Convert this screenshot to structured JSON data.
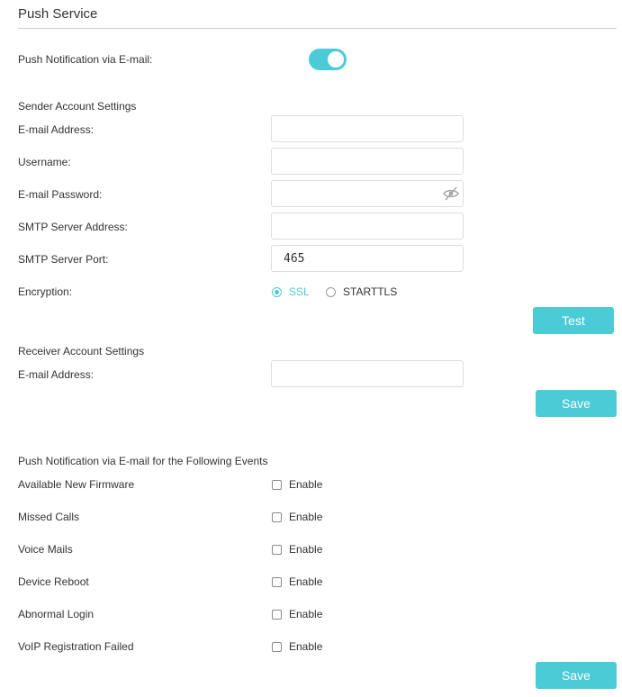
{
  "header": {
    "title": "Push Service"
  },
  "push_toggle": {
    "label": "Push Notification via E-mail:",
    "on": true
  },
  "sender": {
    "section_title": "Sender Account Settings",
    "email_label": "E-mail Address:",
    "email_value": "",
    "username_label": "Username:",
    "username_value": "",
    "password_label": "E-mail Password:",
    "password_value": "",
    "smtp_address_label": "SMTP Server Address:",
    "smtp_address_value": "",
    "smtp_port_label": "SMTP Server Port:",
    "smtp_port_value": "465",
    "encryption_label": "Encryption:",
    "encryption_options": [
      "SSL",
      "STARTTLS"
    ],
    "encryption_selected": "SSL",
    "test_button": "Test"
  },
  "receiver": {
    "section_title": "Receiver Account Settings",
    "email_label": "E-mail Address:",
    "email_value": "",
    "save_button": "Save"
  },
  "events": {
    "section_title": "Push Notification via E-mail for the Following Events",
    "enable_label": "Enable",
    "items": [
      {
        "label": "Available New Firmware",
        "checked": false
      },
      {
        "label": "Missed Calls",
        "checked": false
      },
      {
        "label": "Voice Mails",
        "checked": false
      },
      {
        "label": "Device Reboot",
        "checked": false
      },
      {
        "label": "Abnormal Login",
        "checked": false
      },
      {
        "label": "VoIP Registration Failed",
        "checked": false
      }
    ],
    "save_button": "Save"
  },
  "colors": {
    "accent": "#4acbd6",
    "border": "#dddddd",
    "text": "#333333"
  },
  "icons": {
    "password_toggle": "eye-slash-icon"
  }
}
